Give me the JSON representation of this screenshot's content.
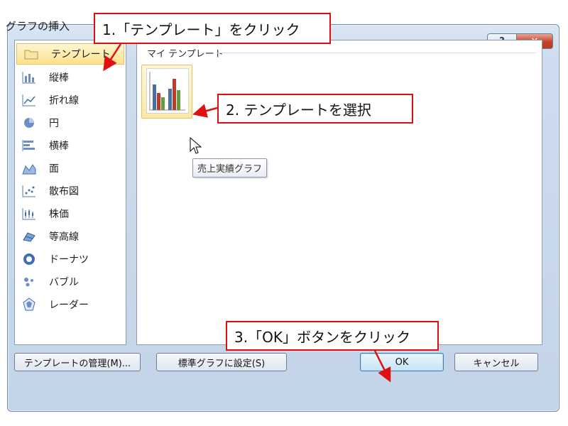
{
  "dialog": {
    "title": "グラフの挿入",
    "help_label": "?",
    "close_label": "✕"
  },
  "sidebar": {
    "items": [
      {
        "label": "テンプレート",
        "icon": "folder-icon",
        "selected": true
      },
      {
        "label": "縦棒",
        "icon": "column-chart-icon"
      },
      {
        "label": "折れ線",
        "icon": "line-chart-icon"
      },
      {
        "label": "円",
        "icon": "pie-chart-icon"
      },
      {
        "label": "横棒",
        "icon": "bar-chart-icon"
      },
      {
        "label": "面",
        "icon": "area-chart-icon"
      },
      {
        "label": "散布図",
        "icon": "scatter-chart-icon"
      },
      {
        "label": "株価",
        "icon": "stock-chart-icon"
      },
      {
        "label": "等高線",
        "icon": "surface-chart-icon"
      },
      {
        "label": "ドーナツ",
        "icon": "doughnut-chart-icon"
      },
      {
        "label": "バブル",
        "icon": "bubble-chart-icon"
      },
      {
        "label": "レーダー",
        "icon": "radar-chart-icon"
      }
    ]
  },
  "main": {
    "section_label": "マイ テンプレート",
    "template_tooltip": "売上実績グラフ"
  },
  "footer": {
    "manage_label": "テンプレートの管理(M)...",
    "set_default_label": "標準グラフに設定(S)",
    "ok_label": "OK",
    "cancel_label": "キャンセル"
  },
  "callouts": {
    "step1": "1.「テンプレート」をクリック",
    "step2": "2. テンプレートを選択",
    "step3": "3.「OK」ボタンをクリック"
  },
  "colors": {
    "callout_border": "#e01010",
    "selection": "#fde28a",
    "ok_border": "#3c7fb1"
  }
}
